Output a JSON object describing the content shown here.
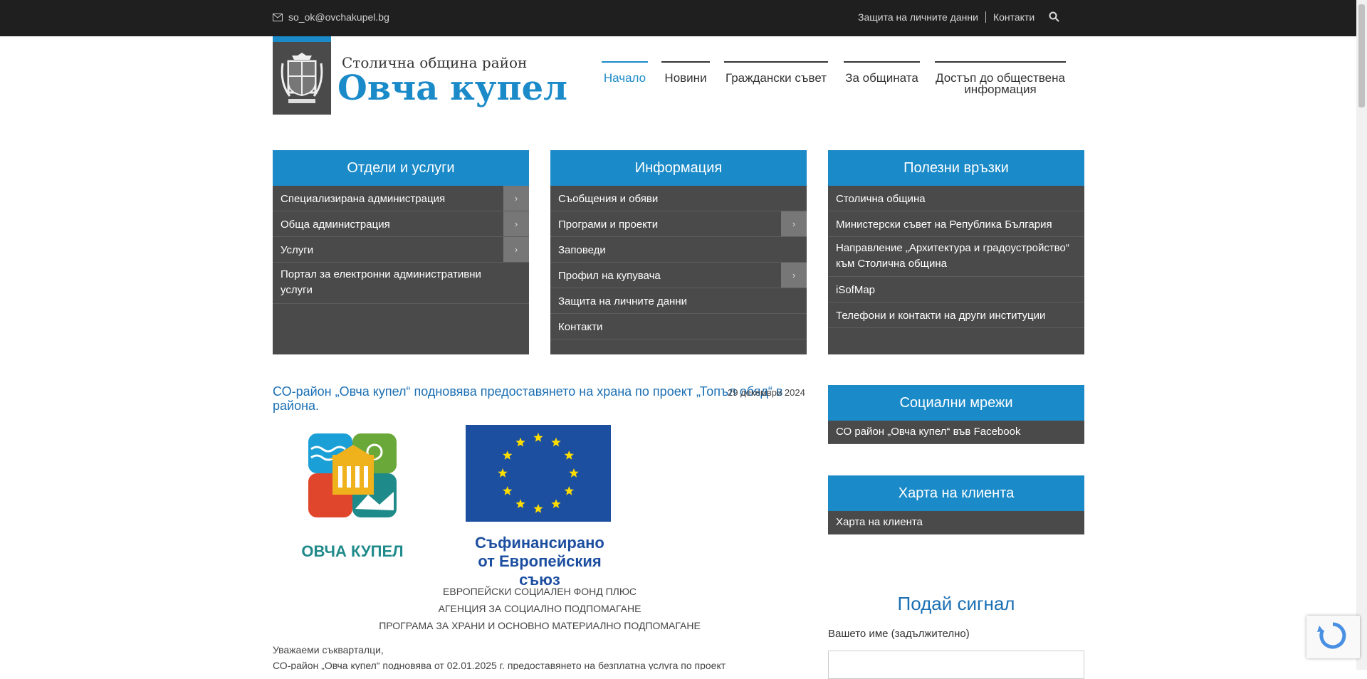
{
  "topbar": {
    "email": "so_ok@ovchakupel.bg",
    "privacy_link": "Защита на личните данни",
    "contacts_link": "Контакти"
  },
  "logo": {
    "line1": "Столична община район",
    "line2": "Овча купел"
  },
  "nav": [
    {
      "label": "Начало"
    },
    {
      "label": "Новини"
    },
    {
      "label": "Граждански съвет"
    },
    {
      "label": "За общината"
    },
    {
      "label": "Достъп до обществена информация"
    }
  ],
  "boxes": {
    "departments": {
      "title": "Отдели и услуги",
      "items": [
        {
          "label": "Специализирана администрация"
        },
        {
          "label": "Обща администрация"
        },
        {
          "label": "Услуги"
        },
        {
          "label": "Портал за електронни административни услуги"
        }
      ]
    },
    "info": {
      "title": "Информация",
      "items": [
        {
          "label": "Съобщения и обяви"
        },
        {
          "label": "Програми и проекти"
        },
        {
          "label": "Заповеди"
        },
        {
          "label": "Профил на купувача"
        },
        {
          "label": "Защита на личните данни"
        },
        {
          "label": "Контакти"
        }
      ]
    },
    "links": {
      "title": "Полезни връзки",
      "items": [
        {
          "label": "Столична община"
        },
        {
          "label": "Министерски съвет на Република България"
        },
        {
          "label": "Направление „Архитектура и градоустройство“ към Столична община"
        },
        {
          "label": "iSofMap"
        },
        {
          "label": "Телефони и контакти на други институции"
        }
      ]
    },
    "social": {
      "title": "Социални мрежи",
      "items": [
        {
          "label": "СО район „Овча купел“ във Facebook"
        }
      ]
    },
    "charter": {
      "title": "Харта на клиента",
      "items": [
        {
          "label": "Харта на клиента"
        }
      ]
    }
  },
  "news": {
    "title": "СО-район „Овча купел“ подновява предоставянето на храна по проект „Топъл обяд“ в района.",
    "date": "29 декември 2024",
    "logo_text": "ОВЧА КУПЕЛ",
    "eu_text": "Съфинансирано от Европейския съюз",
    "lines": [
      "ЕВРОПЕЙСКИ СОЦИАЛЕН ФОНД ПЛЮС",
      "АГЕНЦИЯ ЗА СОЦИАЛНО ПОДПОМАГАНЕ",
      "ПРОГРАМА ЗА ХРАНИ И ОСНОВНО МАТЕРИАЛНО ПОДПОМАГАНЕ"
    ],
    "greeting": "Уважаеми съкварталци,",
    "body": "СО-район „Овча купел“ подновява от 02.01.2025 г. предоставянето на безплатна услуга по проект"
  },
  "signal": {
    "title": "Подай сигнал",
    "name_label": "Вашето име (задължително)"
  },
  "colors": {
    "accent": "#1a8ac8",
    "box_bg": "#4a4a4a",
    "topbar": "#1f1f1f"
  }
}
